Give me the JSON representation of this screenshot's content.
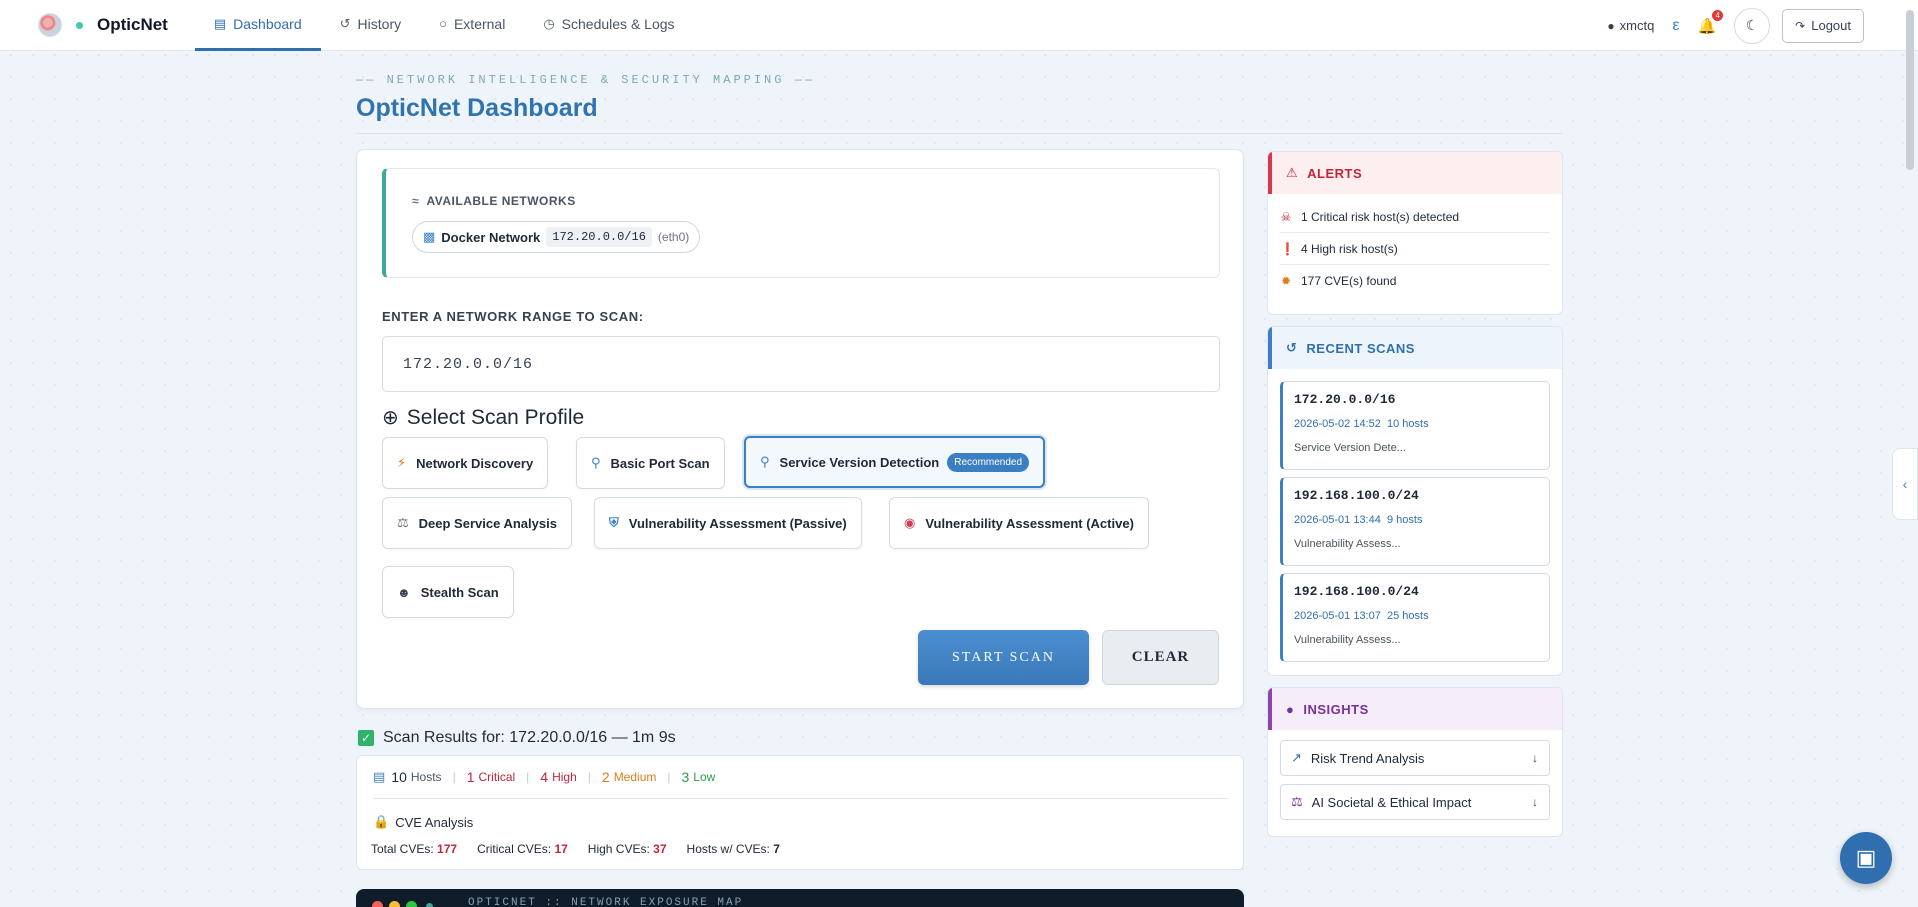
{
  "nav": {
    "brand": "OpticNet",
    "tabs": [
      {
        "label": "Dashboard",
        "icon": "sitemap-icon",
        "active": true
      },
      {
        "label": "History",
        "icon": "history-icon"
      },
      {
        "label": "External",
        "icon": "globe-icon"
      },
      {
        "label": "Schedules & Logs",
        "icon": "clock-icon"
      }
    ],
    "user": "xmctq",
    "notification_count": "4",
    "logout_label": "Logout"
  },
  "header": {
    "eyebrow": "NETWORK INTELLIGENCE & SECURITY MAPPING",
    "title": "OpticNet Dashboard"
  },
  "networks": {
    "label": "AVAILABLE NETWORKS",
    "items": [
      {
        "name": "Docker Network",
        "cidr": "172.20.0.0/16",
        "iface": "(eth0)"
      }
    ]
  },
  "scan_form": {
    "range_label": "ENTER A NETWORK RANGE TO SCAN:",
    "range_value": "172.20.0.0/16",
    "profile_heading": "Select Scan Profile",
    "profiles": [
      {
        "label": "Network Discovery",
        "icon": "lightning-icon"
      },
      {
        "label": "Basic Port Scan",
        "icon": "magnifier-icon"
      },
      {
        "label": "Service Version Detection",
        "icon": "magnifier-right-icon",
        "badge": "Recommended",
        "selected": true
      },
      {
        "label": "Deep Service Analysis",
        "icon": "microscope-icon"
      },
      {
        "label": "Vulnerability Assessment (Passive)",
        "icon": "shield-icon"
      },
      {
        "label": "Vulnerability Assessment (Active)",
        "icon": "target-icon"
      },
      {
        "label": "Stealth Scan",
        "icon": "ninja-icon"
      }
    ],
    "start_label": "START SCAN",
    "clear_label": "CLEAR"
  },
  "results": {
    "title": "Scan Results for: 172.20.0.0/16 — 1m 9s",
    "stats": [
      {
        "num": "10",
        "label": "Hosts",
        "color": "#1f2937"
      },
      {
        "num": "1",
        "label": "Critical",
        "color": "#c0263a"
      },
      {
        "num": "4",
        "label": "High",
        "color": "#c0263a"
      },
      {
        "num": "2",
        "label": "Medium",
        "color": "#e07b18"
      },
      {
        "num": "3",
        "label": "Low",
        "color": "#2f9a4f"
      }
    ],
    "cve_title": "CVE Analysis",
    "cve": [
      {
        "label": "Total CVEs:",
        "value": "177",
        "color": "#c0263a"
      },
      {
        "label": "Critical CVEs:",
        "value": "17",
        "color": "#c0263a"
      },
      {
        "label": "High CVEs:",
        "value": "37",
        "color": "#c0263a"
      },
      {
        "label": "Hosts w/ CVEs:",
        "value": "7",
        "color": "#1f2937"
      }
    ],
    "terminal_title": "OPTICNET :: NETWORK EXPOSURE MAP"
  },
  "alerts": {
    "title": "ALERTS",
    "items": [
      {
        "text": "1 Critical risk host(s) detected",
        "icon": "skull-icon",
        "color": "#c0263a"
      },
      {
        "text": "4 High risk host(s)",
        "icon": "exclamation-circle-icon",
        "color": "#d32f2f"
      },
      {
        "text": "177 CVE(s) found",
        "icon": "bug-icon",
        "color": "#e07b18"
      }
    ]
  },
  "recent_scans": {
    "title": "RECENT SCANS",
    "items": [
      {
        "ip": "172.20.0.0/16",
        "date": "2026-05-02 14:52",
        "hosts": "10 hosts",
        "profile": "Service Version Dete..."
      },
      {
        "ip": "192.168.100.0/24",
        "date": "2026-05-01 13:44",
        "hosts": "9 hosts",
        "profile": "Vulnerability Assess..."
      },
      {
        "ip": "192.168.100.0/24",
        "date": "2026-05-01 13:07",
        "hosts": "25 hosts",
        "profile": "Vulnerability Assess..."
      }
    ]
  },
  "insights": {
    "title": "INSIGHTS",
    "items": [
      {
        "label": "Risk Trend Analysis",
        "icon": "chart-line-icon"
      },
      {
        "label": "AI Societal & Ethical Impact",
        "icon": "scale-icon"
      }
    ]
  }
}
